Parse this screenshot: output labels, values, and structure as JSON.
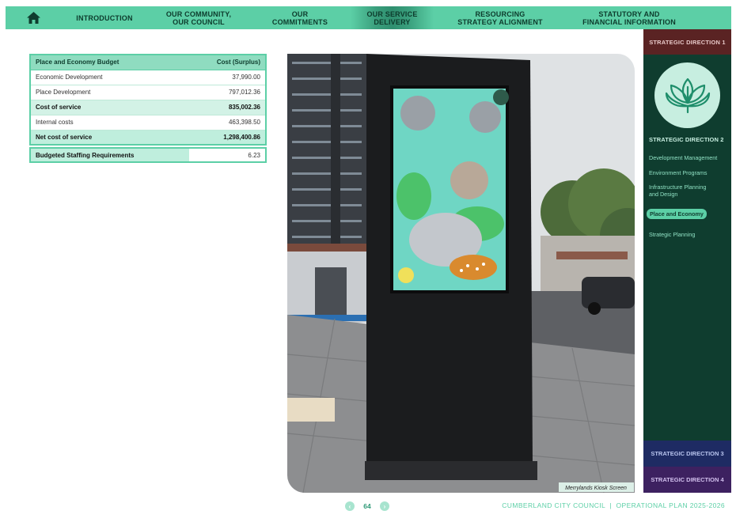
{
  "nav": {
    "home_icon": "home-icon",
    "items": [
      {
        "line1": "INTRODUCTION",
        "line2": ""
      },
      {
        "line1": "OUR COMMUNITY,",
        "line2": "OUR COUNCIL"
      },
      {
        "line1": "OUR",
        "line2": "COMMITMENTS"
      },
      {
        "line1": "OUR SERVICE",
        "line2": "DELIVERY"
      },
      {
        "line1": "RESOURCING",
        "line2": "STRATEGY ALIGNMENT"
      },
      {
        "line1": "STATUTORY AND",
        "line2": "FINANCIAL INFORMATION"
      }
    ],
    "active_index": 3
  },
  "sidebar": {
    "direction1": "STRATEGIC DIRECTION 1",
    "direction2": "STRATEGIC DIRECTION 2",
    "direction3": "STRATEGIC DIRECTION 3",
    "direction4": "STRATEGIC DIRECTION 4",
    "emblem_icon": "lotus-leaf-icon",
    "links": [
      {
        "label": "Development Management",
        "active": false
      },
      {
        "label": "Environment Programs",
        "active": false
      },
      {
        "label": "Infrastructure Planning and Design",
        "active": false
      },
      {
        "label": "Place and Economy",
        "active": true
      },
      {
        "label": "Strategic Planning",
        "active": false
      }
    ]
  },
  "budget": {
    "header_label": "Place and Economy Budget",
    "header_value": "Cost (Surplus)",
    "rows": [
      {
        "label": "Economic Development",
        "value": "37,990.00",
        "style": "normal"
      },
      {
        "label": "Place Development",
        "value": "797,012.36",
        "style": "normal"
      },
      {
        "label": "Cost of service",
        "value": "835,002.36",
        "style": "bold"
      },
      {
        "label": "Internal costs",
        "value": "463,398.50",
        "style": "normal"
      },
      {
        "label": "Net cost of service",
        "value": "1,298,400.86",
        "style": "total"
      }
    ]
  },
  "staffing": {
    "label": "Budgeted Staffing Requirements",
    "value": "6.23"
  },
  "photo": {
    "caption": "Merrylands Kiosk Screen"
  },
  "pager": {
    "page": "64",
    "prev_icon": "chevron-left-icon",
    "next_icon": "chevron-right-icon"
  },
  "footer": {
    "text": "CUMBERLAND CITY COUNCIL  |  OPERATIONAL PLAN 2025-2026"
  },
  "colors": {
    "accent": "#5ccfa6",
    "sidebar_bg": "#0f3d2f",
    "direction1": "#5a2323",
    "direction3": "#1e2b63",
    "direction4": "#3d2160"
  }
}
